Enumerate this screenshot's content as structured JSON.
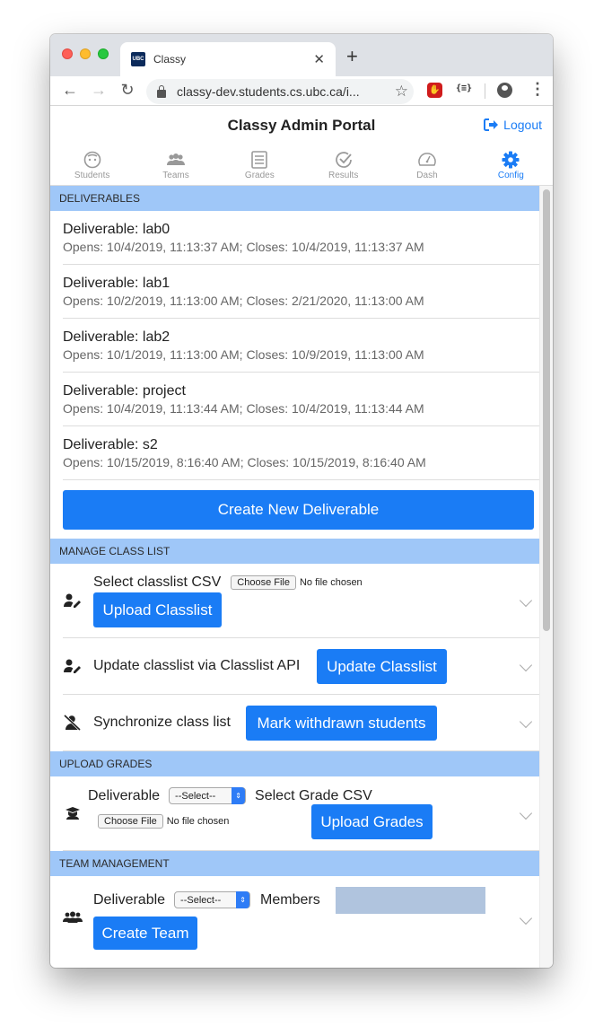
{
  "browser": {
    "tab_title": "Classy",
    "favicon_text": "UBC",
    "url": "classy-dev.students.cs.ubc.ca/i...",
    "ext_json_label": "{≡}"
  },
  "app": {
    "title": "Classy Admin Portal",
    "logout_label": "Logout"
  },
  "nav_tabs": [
    {
      "label": "Students",
      "icon": "face-icon"
    },
    {
      "label": "Teams",
      "icon": "people-icon"
    },
    {
      "label": "Grades",
      "icon": "clipboard-icon"
    },
    {
      "label": "Results",
      "icon": "check-circle-icon"
    },
    {
      "label": "Dash",
      "icon": "speedometer-icon"
    },
    {
      "label": "Config",
      "icon": "gear-icon",
      "active": true
    }
  ],
  "deliverables": {
    "header": "DELIVERABLES",
    "items": [
      {
        "name": "Deliverable: lab0",
        "dates": "Opens: 10/4/2019, 11:13:37 AM; Closes: 10/4/2019, 11:13:37 AM"
      },
      {
        "name": "Deliverable: lab1",
        "dates": "Opens: 10/2/2019, 11:13:00 AM; Closes: 2/21/2020, 11:13:00 AM"
      },
      {
        "name": "Deliverable: lab2",
        "dates": "Opens: 10/1/2019, 11:13:00 AM; Closes: 10/9/2019, 11:13:00 AM"
      },
      {
        "name": "Deliverable: project",
        "dates": "Opens: 10/4/2019, 11:13:44 AM; Closes: 10/4/2019, 11:13:44 AM"
      },
      {
        "name": "Deliverable: s2",
        "dates": "Opens: 10/15/2019, 8:16:40 AM; Closes: 10/15/2019, 8:16:40 AM"
      }
    ],
    "create_button": "Create New Deliverable"
  },
  "class_list": {
    "header": "MANAGE CLASS LIST",
    "select_label": "Select classlist CSV",
    "choose_file": "Choose File",
    "no_file": "No file chosen",
    "upload_button": "Upload Classlist",
    "api_label": "Update classlist via Classlist API",
    "update_button": "Update Classlist",
    "sync_label": "Synchronize class list",
    "withdrawn_button": "Mark withdrawn students"
  },
  "grades": {
    "header": "UPLOAD GRADES",
    "deliverable_label": "Deliverable",
    "select_value": "--Select--",
    "csv_label": "Select Grade CSV",
    "choose_file": "Choose File",
    "no_file": "No file chosen",
    "upload_button": "Upload Grades"
  },
  "teams": {
    "header": "TEAM MANAGEMENT",
    "deliverable_label": "Deliverable",
    "select_value": "--Select--",
    "members_label": "Members",
    "members_value": "",
    "create_button": "Create Team"
  },
  "colors": {
    "accent": "#1a7cf5",
    "section_header": "#9fc7f8",
    "members_box": "#b0c4de"
  }
}
